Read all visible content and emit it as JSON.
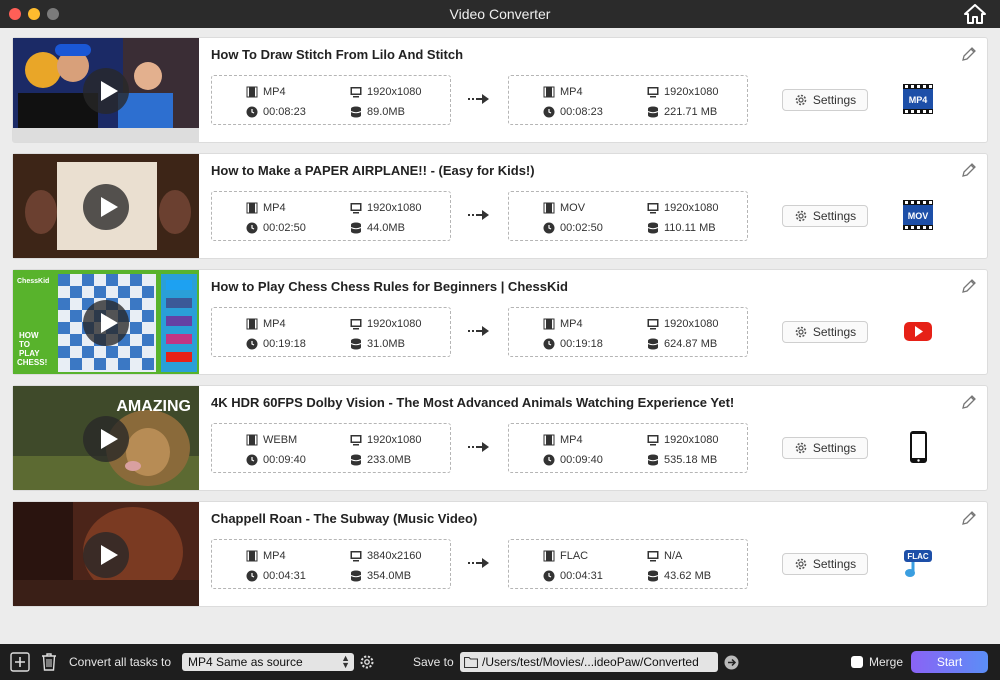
{
  "window": {
    "title": "Video Converter"
  },
  "tasks": [
    {
      "title": "How To Draw Stitch From Lilo And Stitch",
      "source": {
        "format": "MP4",
        "resolution": "1920x1080",
        "duration": "00:08:23",
        "size": "89.0MB"
      },
      "output": {
        "format": "MP4",
        "resolution": "1920x1080",
        "duration": "00:08:23",
        "size": "221.71 MB"
      },
      "settings_label": "Settings",
      "output_icon": "mp4-format-icon",
      "output_icon_label": "MP4"
    },
    {
      "title": "How to Make a PAPER AIRPLANE!! - (Easy for Kids!)",
      "source": {
        "format": "MP4",
        "resolution": "1920x1080",
        "duration": "00:02:50",
        "size": "44.0MB"
      },
      "output": {
        "format": "MOV",
        "resolution": "1920x1080",
        "duration": "00:02:50",
        "size": "110.11 MB"
      },
      "settings_label": "Settings",
      "output_icon": "mov-format-icon",
      "output_icon_label": "MOV"
    },
    {
      "title": "How to Play Chess  Chess Rules for Beginners | ChessKid",
      "source": {
        "format": "MP4",
        "resolution": "1920x1080",
        "duration": "00:19:18",
        "size": "31.0MB"
      },
      "output": {
        "format": "MP4",
        "resolution": "1920x1080",
        "duration": "00:19:18",
        "size": "624.87 MB"
      },
      "settings_label": "Settings",
      "output_icon": "youtube-icon",
      "output_icon_label": ""
    },
    {
      "title": "4K HDR 60FPS Dolby Vision - The Most Advanced Animals Watching Experience Yet!",
      "source": {
        "format": "WEBM",
        "resolution": "1920x1080",
        "duration": "00:09:40",
        "size": "233.0MB"
      },
      "output": {
        "format": "MP4",
        "resolution": "1920x1080",
        "duration": "00:09:40",
        "size": "535.18 MB"
      },
      "settings_label": "Settings",
      "output_icon": "phone-icon",
      "output_icon_label": ""
    },
    {
      "title": "Chappell Roan - The Subway (Music Video)",
      "source": {
        "format": "MP4",
        "resolution": "3840x2160",
        "duration": "00:04:31",
        "size": "354.0MB"
      },
      "output": {
        "format": "FLAC",
        "resolution": "N/A",
        "duration": "00:04:31",
        "size": "43.62 MB"
      },
      "settings_label": "Settings",
      "output_icon": "flac-format-icon",
      "output_icon_label": "FLAC"
    }
  ],
  "thumb_texts": {
    "chesskid_logo": "ChessKid",
    "chess_howto": "HOW TO PLAY CHESS!",
    "amazing": "AMAZING"
  },
  "bottom": {
    "convert_label": "Convert all tasks to",
    "convert_value": "MP4 Same as source",
    "save_label": "Save to",
    "save_path": "/Users/test/Movies/...ideoPaw/Converted",
    "merge_label": "Merge",
    "start_label": "Start"
  }
}
